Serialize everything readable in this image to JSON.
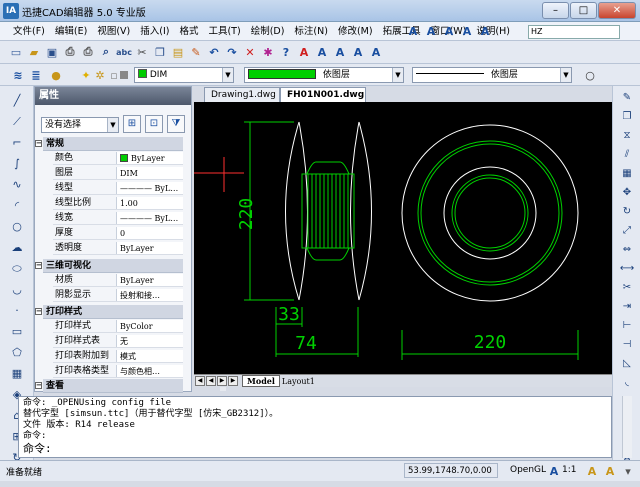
{
  "window": {
    "title": "迅捷CAD编辑器 5.0 专业版",
    "app_icon_text": "IA",
    "controls": {
      "minimize": "–",
      "maximize": "□",
      "close": "✕"
    }
  },
  "menubar": {
    "items": [
      "文件(F)",
      "编辑(E)",
      "视图(V)",
      "插入(I)",
      "格式",
      "工具(T)",
      "绘制(D)",
      "标注(N)",
      "修改(M)",
      "拓展工具",
      "窗口(W)",
      "说明(H)"
    ]
  },
  "text_style_box": {
    "value": "HZ"
  },
  "toolbar2": {
    "layer_name": "DIM",
    "linecolor": "依图层",
    "linetype": "依图层"
  },
  "properties": {
    "title": "属性",
    "selection": "没有选择",
    "sections": {
      "general": {
        "title": "常规",
        "rows": [
          {
            "k": "颜色",
            "v": "ByLayer"
          },
          {
            "k": "图层",
            "v": "DIM"
          },
          {
            "k": "线型",
            "v": "———— ByL…"
          },
          {
            "k": "线型比例",
            "v": "1.00"
          },
          {
            "k": "线宽",
            "v": "———— ByL…"
          },
          {
            "k": "厚度",
            "v": "0"
          },
          {
            "k": "透明度",
            "v": "ByLayer"
          }
        ]
      },
      "viz3d": {
        "title": "三维可视化",
        "rows": [
          {
            "k": "材质",
            "v": "ByLayer"
          },
          {
            "k": "阴影显示",
            "v": "投射和接…"
          }
        ]
      },
      "plot": {
        "title": "打印样式",
        "rows": [
          {
            "k": "打印样式",
            "v": "ByColor"
          },
          {
            "k": "打印样式表",
            "v": "无"
          },
          {
            "k": "打印表附加到",
            "v": "模式"
          },
          {
            "k": "打印表格类型",
            "v": "与颜色相…"
          }
        ]
      },
      "view": {
        "title": "查看"
      }
    }
  },
  "doc_tabs": [
    {
      "label": "Drawing1.dwg",
      "active": false
    },
    {
      "label": "FH01N001.dwg",
      "active": true,
      "close": "×"
    }
  ],
  "drawing": {
    "dim_height": "220",
    "dim_small": "33",
    "dim_mid": "74",
    "dim_width": "220"
  },
  "layout_tabs": {
    "model": "Model",
    "layout": "Layout1"
  },
  "command": {
    "lines": [
      "命令: _OPENUsing config file",
      "替代字型 [simsun.ttc]（用于替代字型 [仿宋_GB2312]）。",
      "文件 版本: R14 release",
      "命令:"
    ],
    "prompt": "命令:"
  },
  "status": {
    "ready": "准备就绪",
    "coords": "53.99,1748.70,0.00",
    "renderer": "OpenGL",
    "scale": "1:1"
  },
  "colors": {
    "accent_green": "#00d000",
    "layer_green": "#00cc00",
    "canvas": "#000000"
  }
}
